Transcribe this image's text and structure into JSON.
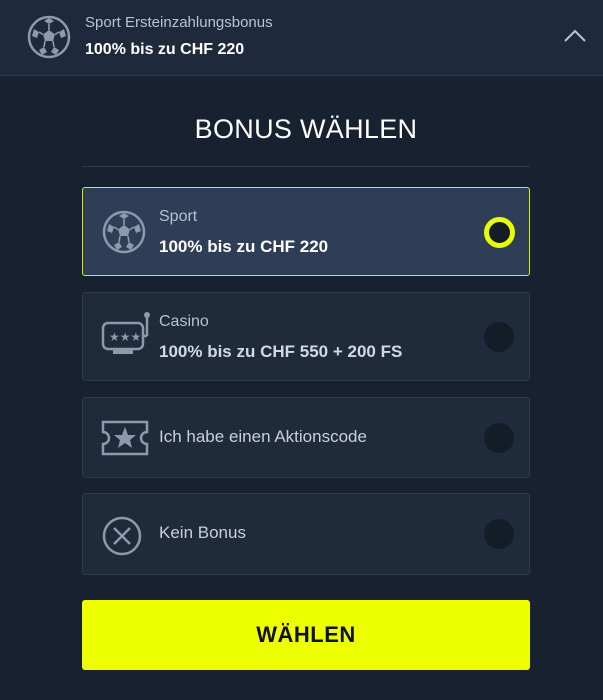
{
  "header": {
    "subtitle": "Sport Ersteinzahlungsbonus",
    "title": "100% bis zu CHF 220",
    "icon": "soccer-ball-icon",
    "toggle_icon": "chevron-up-icon"
  },
  "page_title": "BONUS WÄHLEN",
  "options": [
    {
      "subtitle": "Sport",
      "title": "100% bis zu CHF 220",
      "icon": "soccer-ball-icon",
      "selected": true
    },
    {
      "subtitle": "Casino",
      "title": "100% bis zu CHF 550 + 200 FS",
      "icon": "slot-machine-icon",
      "selected": false
    },
    {
      "label": "Ich habe einen Aktionscode",
      "icon": "ticket-star-icon",
      "selected": false
    },
    {
      "label": "Kein Bonus",
      "icon": "close-circle-icon",
      "selected": false
    }
  ],
  "cta": {
    "label": "WÄHLEN"
  },
  "colors": {
    "background": "#18212f",
    "header": "#1e2a3b",
    "card": "#1f2b3b",
    "card_selected": "#2e3e56",
    "accent": "#eeff00"
  }
}
